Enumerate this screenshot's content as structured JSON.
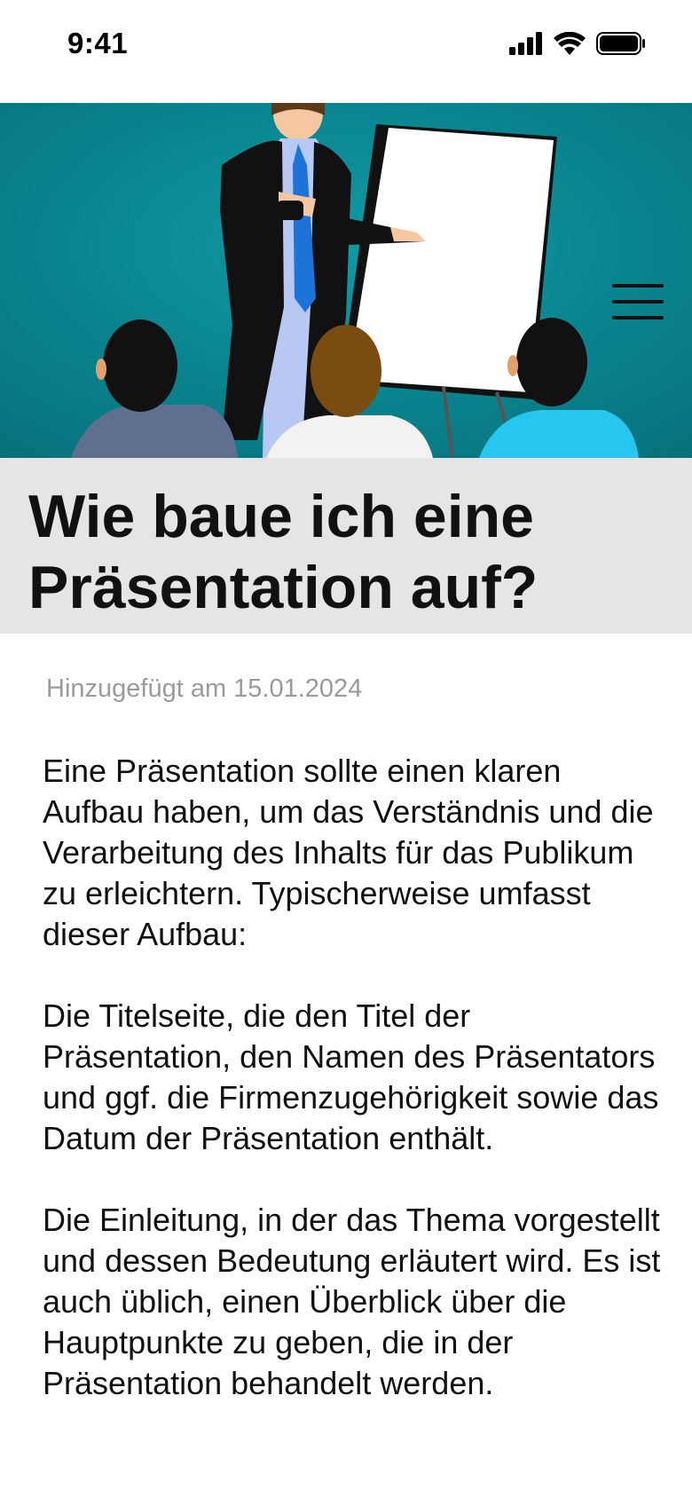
{
  "status_bar": {
    "time": "9:41"
  },
  "header": {
    "menu_icon": "hamburger-menu-icon"
  },
  "article": {
    "title": "Wie baue ich eine Präsentation auf?",
    "date_added": "Hinzugefügt am 15.01.2024",
    "paragraphs": [
      "Eine Präsentation sollte einen klaren Aufbau haben, um das Verständnis und die Verarbeitung des Inhalts für das Publikum zu erleichtern. Typischerweise umfasst dieser Aufbau:",
      "Die Titelseite, die den Titel der Präsentation, den Namen des Präsentators und ggf. die Firmenzugehörigkeit sowie das Datum der Präsentation enthält.",
      "Die Einleitung, in der das Thema vorgestellt und dessen Bedeutung erläutert wird. Es ist auch üblich, einen Überblick über die Hauptpunkte zu geben, die in der Präsentation behandelt werden."
    ]
  },
  "colors": {
    "hero_background": "#0a8590",
    "title_band": "#e5e5e5",
    "meta_text": "#9a9a9a"
  }
}
